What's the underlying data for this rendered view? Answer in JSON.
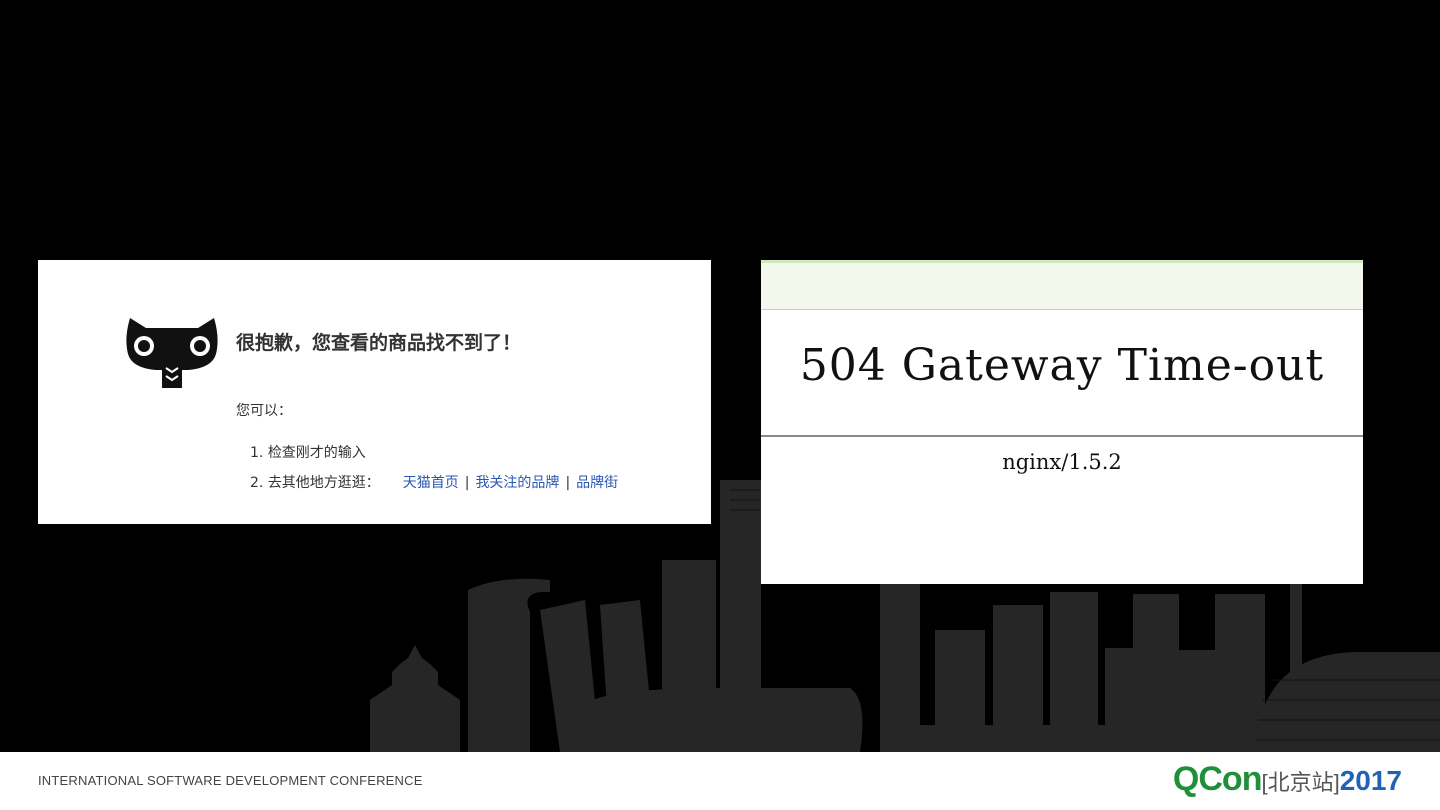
{
  "tmall": {
    "title": "很抱歉，您查看的商品找不到了！",
    "subtitle": "您可以：",
    "items": [
      {
        "num": "1.",
        "text": "检查刚才的输入"
      },
      {
        "num": "2.",
        "text": "去其他地方逛逛："
      }
    ],
    "links": [
      "天猫首页",
      "我关注的品牌",
      "品牌街"
    ],
    "separator": "|",
    "icon": "tmall-cat-logo-icon"
  },
  "gateway": {
    "title": "504 Gateway Time-out",
    "server": "nginx/1.5.2"
  },
  "footer": {
    "conference": "INTERNATIONAL SOFTWARE DEVELOPMENT CONFERENCE",
    "brand": "QCon",
    "site": "[北京站]",
    "year": "2017"
  },
  "colors": {
    "background": "#000000",
    "link": "#2a57b3",
    "brand_green": "#1f8f3a",
    "brand_blue": "#1e63b7"
  }
}
